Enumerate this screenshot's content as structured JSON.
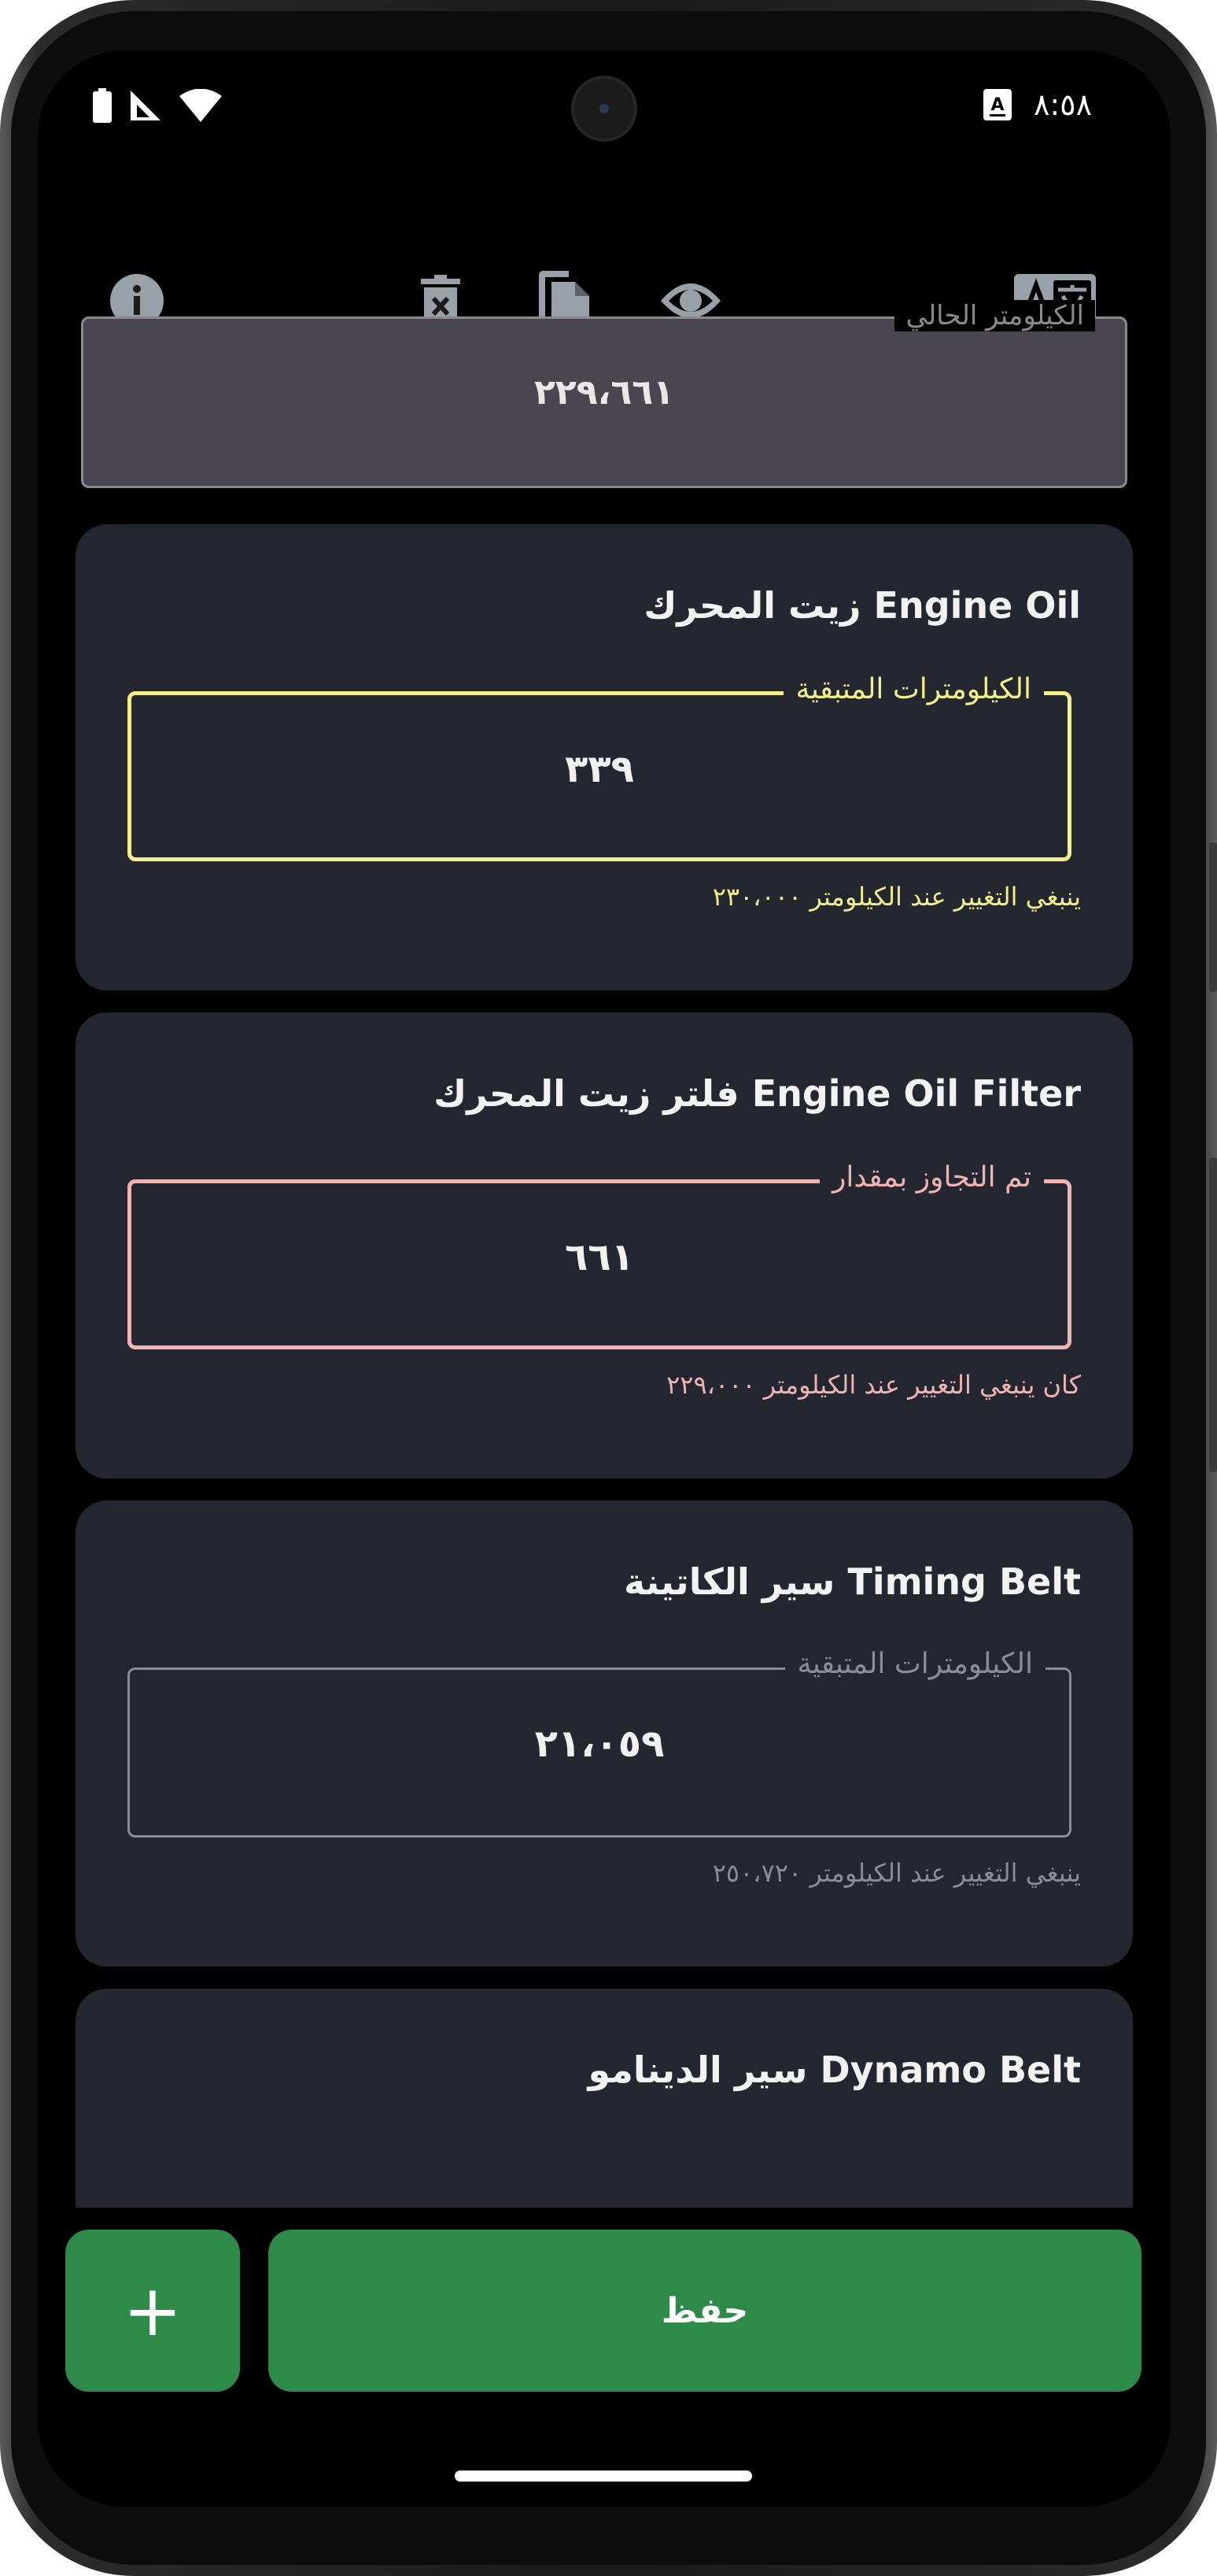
{
  "status_bar": {
    "time": "٨:٥٨",
    "icons": [
      "battery-icon",
      "signal-icon",
      "wifi-icon",
      "translate-badge-icon"
    ]
  },
  "toolbar": {
    "icons": [
      "info-icon",
      "delete-icon",
      "copy-icon",
      "preview-icon",
      "translate-icon"
    ]
  },
  "current_km": {
    "label": "الكيلومتر الحالي",
    "value": "٢٢٩،٦٦١"
  },
  "items": [
    {
      "title": "Engine Oil  زيت المحرك",
      "box_label": "الكيلومترات المتبقية",
      "value": "٣٣٩",
      "hint": "ينبغي التغيير عند الكيلومتر ٢٣٠،٠٠٠",
      "status": "warning",
      "color": "#f2ee8a"
    },
    {
      "title": "Engine Oil Filter  فلتر زيت المحرك",
      "box_label": "تم التجاوز بمقدار",
      "value": "٦٦١",
      "hint": "كان ينبغي التغيير عند الكيلومتر ٢٢٩،٠٠٠",
      "status": "overdue",
      "color": "#eeb4b4"
    },
    {
      "title": "Timing Belt  سير الكاتينة",
      "box_label": "الكيلومترات المتبقية",
      "value": "٢١،٠٥٩",
      "hint": "ينبغي التغيير عند الكيلومتر ٢٥٠،٧٢٠",
      "status": "ok",
      "color": "#8a8d95"
    },
    {
      "title": "Dynamo Belt  سير الدينامو"
    }
  ],
  "actions": {
    "add_label": "+",
    "save_label": "حفظ",
    "accent_color": "#2e8a48"
  }
}
